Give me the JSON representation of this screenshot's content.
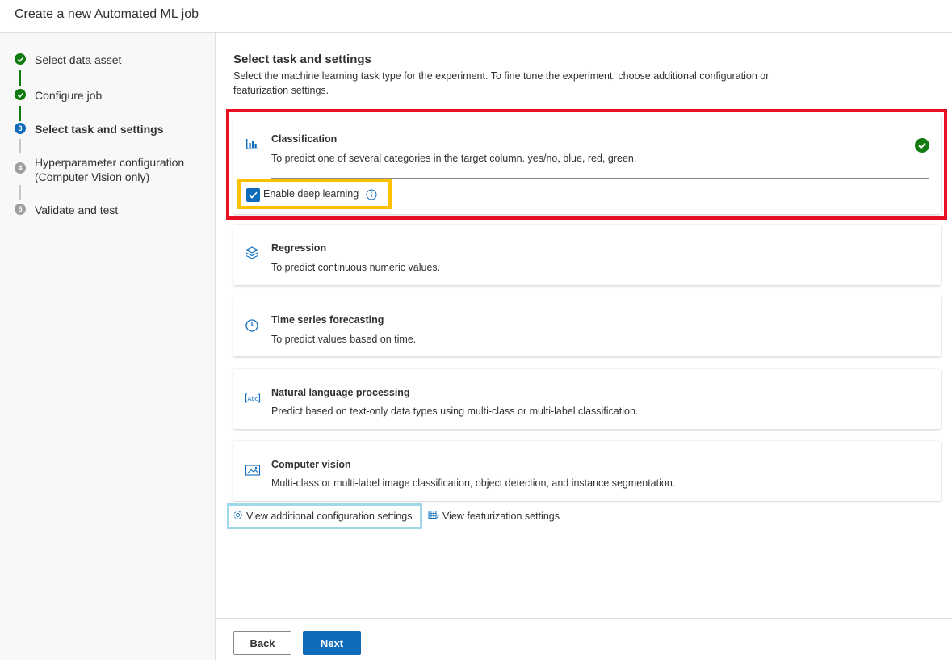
{
  "header": {
    "title": "Create a new Automated ML job"
  },
  "steps": [
    {
      "label": "Select data asset",
      "state": "done"
    },
    {
      "label": "Configure job",
      "state": "done"
    },
    {
      "number": "3",
      "label": "Select task and settings",
      "state": "current"
    },
    {
      "number": "4",
      "label": "Hyperparameter configuration",
      "label2": "(Computer Vision only)",
      "state": "todo"
    },
    {
      "number": "5",
      "label": "Validate and test",
      "state": "todo"
    }
  ],
  "main": {
    "title": "Select task and settings",
    "description": "Select the machine learning task type for the experiment. To fine tune the experiment, choose additional configuration or featurization settings."
  },
  "tasks": [
    {
      "title": "Classification",
      "desc": "To predict one of several categories in the target column. yes/no, blue, red, green.",
      "icon": "bar-chart-icon",
      "selected": true
    },
    {
      "title": "Regression",
      "desc": "To predict continuous numeric values.",
      "icon": "layers-icon",
      "selected": false
    },
    {
      "title": "Time series forecasting",
      "desc": "To predict values based on time.",
      "icon": "clock-icon",
      "selected": false
    },
    {
      "title": "Natural language processing",
      "desc": "Predict based on text-only data types using multi-class or multi-label classification.",
      "icon": "text-abc-icon",
      "selected": false
    },
    {
      "title": "Computer vision",
      "desc": "Multi-class or multi-label image classification, object detection, and instance segmentation.",
      "icon": "image-icon",
      "selected": false
    }
  ],
  "deep_learning": {
    "label": "Enable deep learning",
    "checked": true
  },
  "links": {
    "additional_config": "View additional configuration settings",
    "featurization": "View featurization settings"
  },
  "footer": {
    "back": "Back",
    "next": "Next"
  },
  "colors": {
    "accent": "#0f6cbd",
    "success": "#107c10",
    "highlight_red": "#e81123",
    "highlight_yellow": "#ffc000",
    "highlight_blue": "#9ed8ea"
  }
}
